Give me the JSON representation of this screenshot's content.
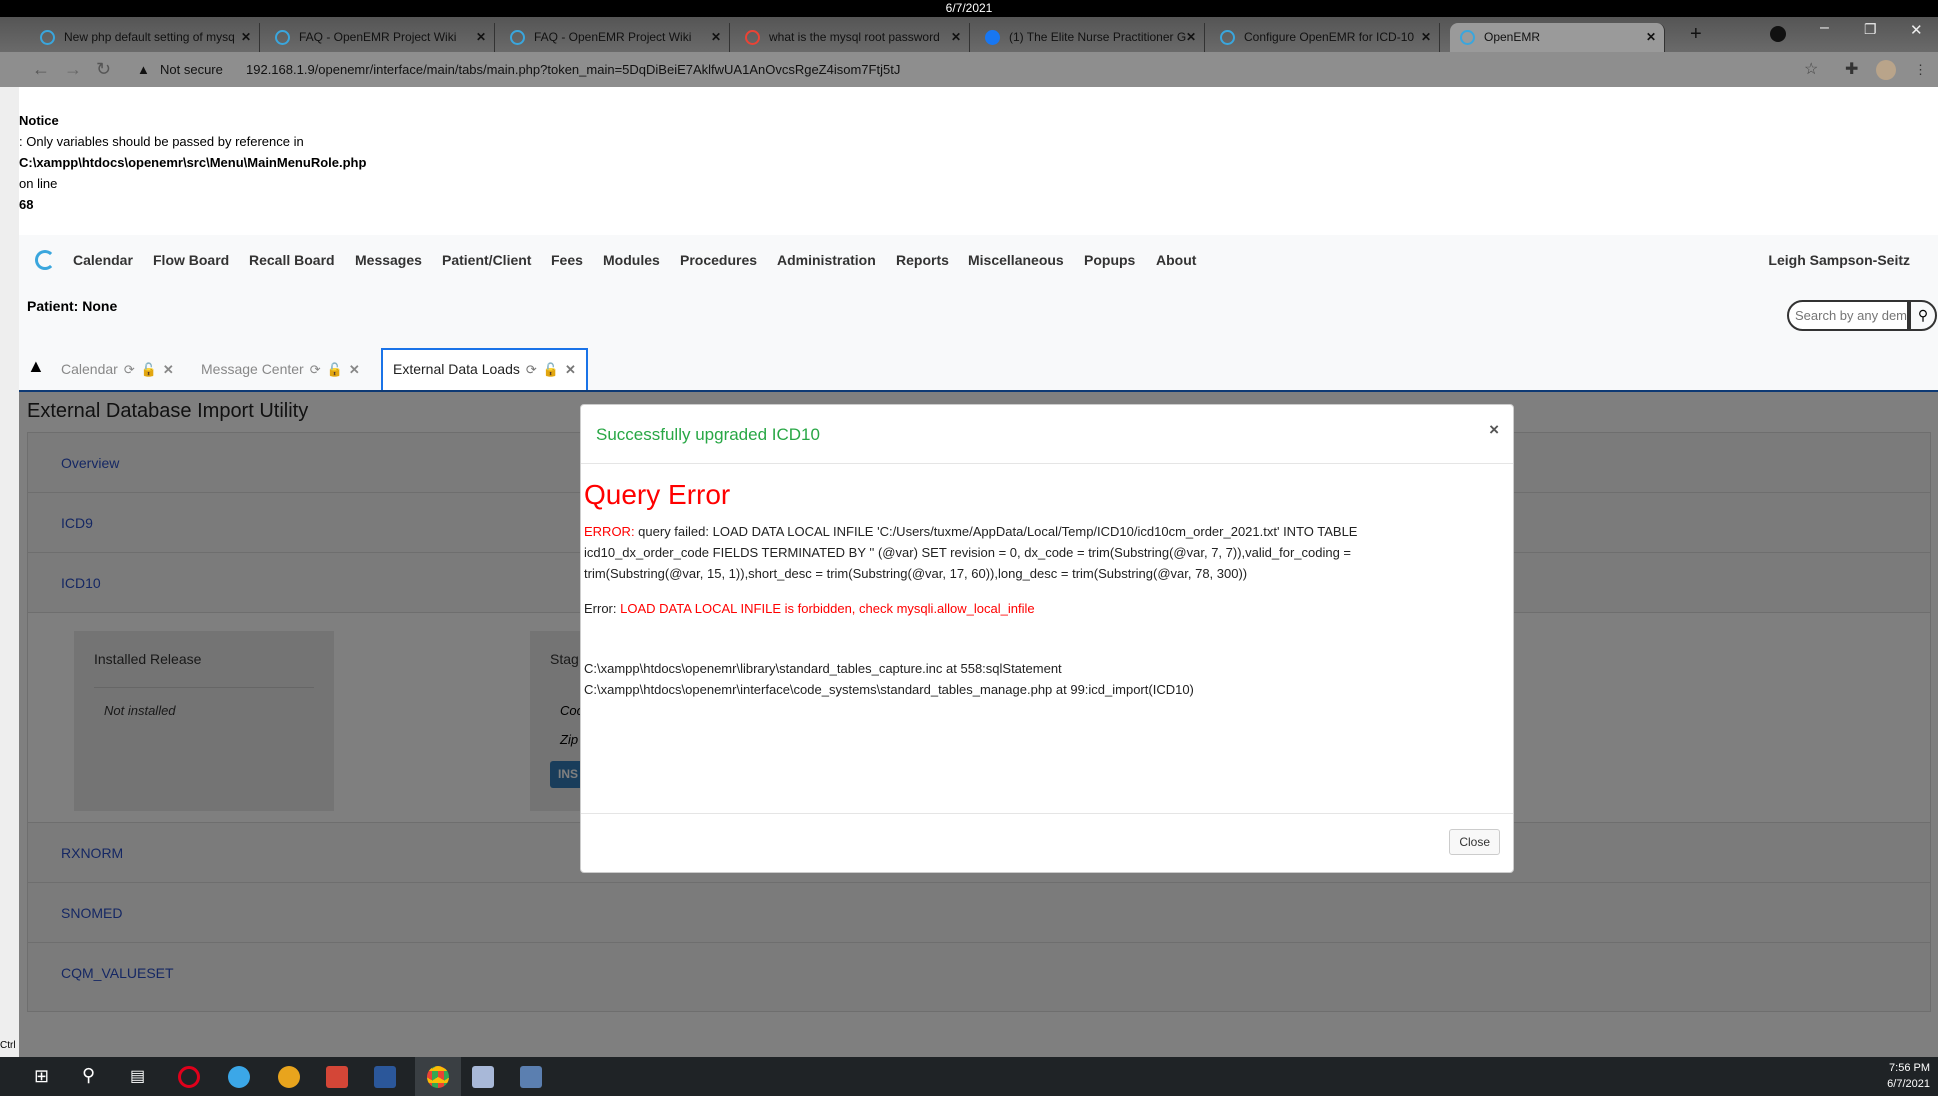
{
  "system": {
    "top_date": "6/7/2021",
    "clock_time": "7:56 PM",
    "clock_date": "6/7/2021",
    "ctrl_label": "Ctrl"
  },
  "browser": {
    "tabs": [
      {
        "title": "New php default setting of mysq",
        "active": false
      },
      {
        "title": "FAQ - OpenEMR Project Wiki",
        "active": false
      },
      {
        "title": "FAQ - OpenEMR Project Wiki",
        "active": false
      },
      {
        "title": "what is the mysql root password",
        "active": false
      },
      {
        "title": "(1) The Elite Nurse Practitioner G",
        "active": false
      },
      {
        "title": "Configure OpenEMR for ICD-10",
        "active": false
      },
      {
        "title": "OpenEMR",
        "active": true
      }
    ],
    "security_label": "Not secure",
    "url": "192.168.1.9/openemr/interface/main/tabs/main.php?token_main=5DqDiBeiE7AklfwUA1AnOvcsRgeZ4isom7Ftj5tJ"
  },
  "notice": {
    "title": "Notice",
    "line1": ": Only variables should be passed by reference in",
    "file": "C:\\xampp\\htdocs\\openemr\\src\\Menu\\MainMenuRole.php",
    "line2": "on line",
    "line_no": "68"
  },
  "menu": {
    "items": [
      "Calendar",
      "Flow Board",
      "Recall Board",
      "Messages",
      "Patient/Client",
      "Fees",
      "Modules",
      "Procedures",
      "Administration",
      "Reports",
      "Miscellaneous",
      "Popups",
      "About"
    ],
    "user": "Leigh Sampson-Seitz"
  },
  "patient": {
    "label": "Patient: None"
  },
  "search": {
    "placeholder": "Search by any demographics"
  },
  "app_tabs": [
    {
      "label": "Calendar",
      "active": false
    },
    {
      "label": "Message Center",
      "active": false
    },
    {
      "label": "External Data Loads",
      "active": true
    }
  ],
  "page": {
    "title": "External Database Import Utility",
    "sections": [
      "Overview",
      "ICD9",
      "ICD10",
      "RXNORM",
      "SNOMED",
      "CQM_VALUESET"
    ],
    "installed_release": {
      "heading": "Installed Release",
      "value": "Not installed"
    },
    "staged": {
      "heading": "Stag",
      "row1": "Coc",
      "row2": "Zip",
      "button": "INS"
    }
  },
  "modal": {
    "title": "Successfully upgraded ICD10",
    "heading": "Query Error",
    "error_prefix": "ERROR:",
    "error_text": " query failed: LOAD DATA LOCAL INFILE 'C:/Users/tuxme/AppData/Local/Temp/ICD10/icd10cm_order_2021.txt' INTO TABLE icd10_dx_order_code FIELDS TERMINATED BY '' (@var) SET revision = 0, dx_code = trim(Substring(@var, 7, 7)),valid_for_coding = trim(Substring(@var, 15, 1)),short_desc = trim(Substring(@var, 17, 60)),long_desc = trim(Substring(@var, 78, 300))",
    "error2_prefix": "Error: ",
    "error2_text": "LOAD DATA LOCAL INFILE is forbidden, check mysqli.allow_local_infile",
    "trace": [
      "C:\\xampp\\htdocs\\openemr\\library\\standard_tables_capture.inc at 558:sqlStatement",
      "C:\\xampp\\htdocs\\openemr\\interface\\code_systems\\standard_tables_manage.php at 99:icd_import(ICD10)"
    ],
    "close_label": "Close"
  },
  "colors": {
    "accent": "#1a73e8",
    "success": "#28a745",
    "error": "#ff0000",
    "link": "#2a4fc6"
  }
}
